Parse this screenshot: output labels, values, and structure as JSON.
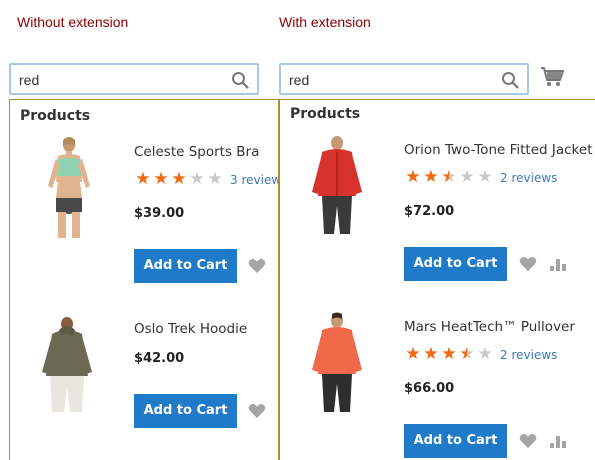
{
  "captions": {
    "left": "Without extension",
    "right": "With extension"
  },
  "search": {
    "left_value": "red",
    "right_value": "red"
  },
  "icons": {
    "search": "search-icon",
    "cart": "cart-icon",
    "wishlist": "heart-icon",
    "compare": "compare-icon"
  },
  "colors": {
    "caption": "#8b0000",
    "button": "#1f7ac9",
    "star": "#f06a0f",
    "link": "#3b77bd",
    "panel_border": "#b38b2c"
  },
  "left_panel": {
    "title": "Products",
    "products": [
      {
        "name": "Celeste Sports Bra",
        "rating": 3,
        "reviews": "3 reviews",
        "price": "$39.00",
        "button": "Add to Cart"
      },
      {
        "name": "Oslo Trek Hoodie",
        "price": "$42.00",
        "button": "Add to Cart"
      }
    ]
  },
  "right_panel": {
    "title": "Products",
    "products": [
      {
        "name": "Orion Two-Tone Fitted Jacket",
        "rating": 2.5,
        "reviews": "2 reviews",
        "price": "$72.00",
        "button": "Add to Cart"
      },
      {
        "name": "Mars HeatTech™ Pullover",
        "rating": 3.5,
        "reviews": "2 reviews",
        "price": "$66.00",
        "button": "Add to Cart"
      }
    ]
  }
}
